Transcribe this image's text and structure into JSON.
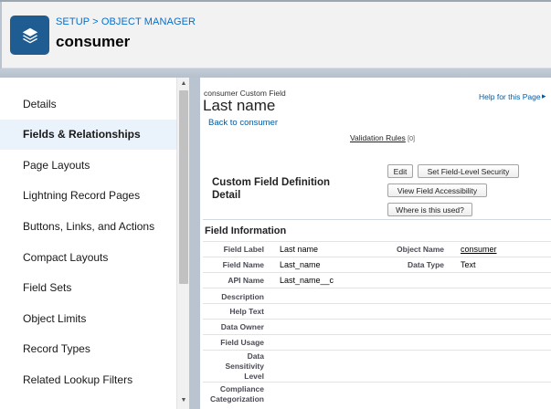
{
  "header": {
    "breadcrumb_setup": "SETUP",
    "breadcrumb_sep": " > ",
    "breadcrumb_object_manager": "OBJECT MANAGER",
    "object_title": "consumer",
    "icon": "layers-icon"
  },
  "sidebar": {
    "items": [
      {
        "label": "Details",
        "active": false
      },
      {
        "label": "Fields & Relationships",
        "active": true
      },
      {
        "label": "Page Layouts",
        "active": false
      },
      {
        "label": "Lightning Record Pages",
        "active": false
      },
      {
        "label": "Buttons, Links, and Actions",
        "active": false
      },
      {
        "label": "Compact Layouts",
        "active": false
      },
      {
        "label": "Field Sets",
        "active": false
      },
      {
        "label": "Object Limits",
        "active": false
      },
      {
        "label": "Record Types",
        "active": false
      },
      {
        "label": "Related Lookup Filters",
        "active": false
      }
    ]
  },
  "main": {
    "subtitle": "consumer Custom Field",
    "title": "Last name",
    "back_link": "Back to consumer",
    "help_link": "Help for this Page",
    "validation_rules_label": "Validation Rules",
    "validation_rules_count": "[0]",
    "section_title": "Custom Field Definition Detail",
    "buttons": {
      "edit": "Edit",
      "set_security": "Set Field-Level Security",
      "view_accessibility": "View Field Accessibility",
      "where_used": "Where is this used?"
    },
    "field_info_title": "Field Information",
    "rows": {
      "field_label": {
        "label": "Field Label",
        "value": "Last name"
      },
      "field_name": {
        "label": "Field Name",
        "value": "Last_name"
      },
      "api_name": {
        "label": "API Name",
        "value": "Last_name__c"
      },
      "description": {
        "label": "Description",
        "value": ""
      },
      "help_text": {
        "label": "Help Text",
        "value": ""
      },
      "data_owner": {
        "label": "Data Owner",
        "value": ""
      },
      "field_usage": {
        "label": "Field Usage",
        "value": ""
      },
      "data_sensitivity": {
        "label": "Data Sensitivity Level",
        "value": ""
      },
      "compliance": {
        "label": "Compliance Categorization",
        "value": ""
      }
    },
    "right_rows": {
      "object_name": {
        "label": "Object Name",
        "value": "consumer"
      },
      "data_type": {
        "label": "Data Type",
        "value": "Text"
      }
    }
  },
  "colors": {
    "link": "#0070d2",
    "brand_icon": "#1f5c91",
    "active_item_bg": "#eaf2fb"
  }
}
